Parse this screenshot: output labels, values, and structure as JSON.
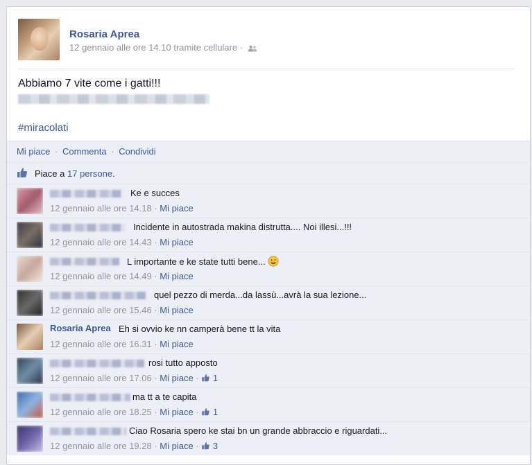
{
  "post": {
    "author": "Rosaria Aprea",
    "meta": "12 gennaio alle ore 14.10 tramite cellulare ·",
    "privacy_icon": "friends-icon",
    "text": "Abbiamo 7 vite come i gatti!!!",
    "hashtag": "#miracolati"
  },
  "actions": {
    "like": "Mi piace",
    "comment": "Commenta",
    "share": "Condividi",
    "separator": "·"
  },
  "likes": {
    "prefix": "Piace a",
    "count": "17 persone",
    "suffix": "."
  },
  "colors": {
    "link": "#3b5998",
    "muted": "#90949c",
    "panel": "#eceff5"
  },
  "comments": [
    {
      "author": "",
      "text": "Ke e succes",
      "time": "12 gennaio alle ore 14.18",
      "like": "Mi piace",
      "likes": ""
    },
    {
      "author": "",
      "text": "Incidente in autostrada makina distrutta.... Noi illesi...!!!",
      "time": "12 gennaio alle ore 14.43",
      "like": "Mi piace",
      "likes": ""
    },
    {
      "author": "",
      "text": "L importante e ke state tutti bene...",
      "time": "12 gennaio alle ore 14.49",
      "like": "Mi piace",
      "likes": ""
    },
    {
      "author": "",
      "text": "quel pezzo di merda...da lassù...avrà la sua lezione...",
      "time": "12 gennaio alle ore 15.46",
      "like": "Mi piace",
      "likes": ""
    },
    {
      "author": "Rosaria Aprea",
      "text": "Eh si ovvio ke nn camperà bene tt la vita",
      "time": "12 gennaio alle ore 16.31",
      "like": "Mi piace",
      "likes": ""
    },
    {
      "author": "",
      "text": "rosi tutto apposto",
      "time": "12 gennaio alle ore 17.06",
      "like": "Mi piace",
      "likes": "1"
    },
    {
      "author": "",
      "text": "ma tt a te capita",
      "time": "12 gennaio alle ore 18.25",
      "like": "Mi piace",
      "likes": "1"
    },
    {
      "author": "",
      "text": "Ciao Rosaria spero ke stai bn un grande abbraccio e riguardati...",
      "time": "12 gennaio alle ore 19.28",
      "like": "Mi piace",
      "likes": "3"
    }
  ]
}
